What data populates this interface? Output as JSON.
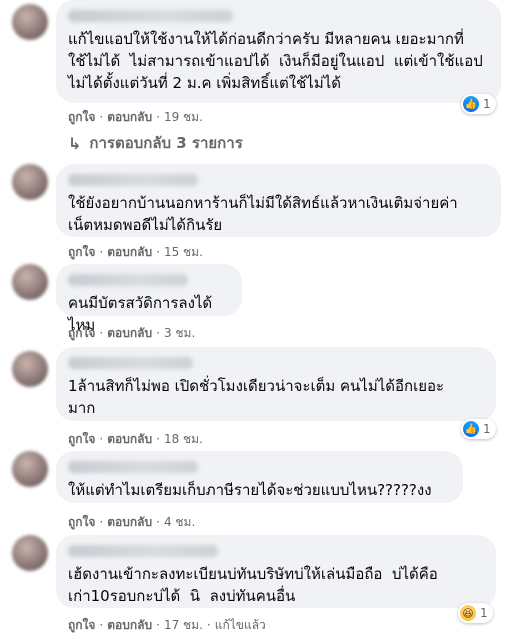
{
  "comments": [
    {
      "text": "แก้ไขแอปให้ใช้งานให้ได้ก่อนดีกว่าครับ มีหลายคน เยอะมากที่\nใช้ไม่ได้  ไม่สามารถเข้าแอปได้  เงินก็มีอยู่ในแอป  แต่เข้าใช้แอป\nไม่ได้ตั้งแต่วันที่ 2 ม.ค เพิ่มสิทธิ์แต่ใช้ไม่ได้",
      "like_label": "ถูกใจ",
      "reply_label": "ตอบกลับ",
      "time": "19 ชม.",
      "reaction_count": "1",
      "reaction_icon": "like-icon"
    },
    {
      "text": "ใช้ยังอยากบ้านนอกหาร้านก็ไม่มีใด้สิทธ์แล้วหาเงินเติมจ่ายค่า\nเน็ตหมดพอดีไม่ได้กินรัย",
      "like_label": "ถูกใจ",
      "reply_label": "ตอบกลับ",
      "time": "15 ชม."
    },
    {
      "text": "คนมีบัตรสวัดิการลงได้ไหม",
      "like_label": "ถูกใจ",
      "reply_label": "ตอบกลับ",
      "time": "3 ชม."
    },
    {
      "text": "1ล้านสิทก็ไม่พอ เปิดชั่วโมงเดียวน่าจะเต็ม คนไม่ได้อีกเยอะ\nมาก",
      "like_label": "ถูกใจ",
      "reply_label": "ตอบกลับ",
      "time": "18 ชม.",
      "reaction_count": "1",
      "reaction_icon": "like-icon"
    },
    {
      "text": "ให้แต่ทำไมเตรียมเก็บภาษีรายได้จะช่วยแบบไหน?????งง",
      "like_label": "ถูกใจ",
      "reply_label": "ตอบกลับ",
      "time": "4 ชม."
    },
    {
      "text": "เฮ้ดงานเข้ากะลงทะเบียนบ่ทันบริษัทบ่ให้เล่นมือถือ  บ่ได้คือ\nเก่า10รอบกะบ่ได้  นิ  ลงบ่ทันคนอื่น",
      "like_label": "ถูกใจ",
      "reply_label": "ตอบกลับ",
      "time": "17 ชม.",
      "edited_label": "แก้ไขแล้ว",
      "reaction_count": "1",
      "reaction_icon": "haha-icon"
    }
  ],
  "replies_link": "การตอบกลับ 3 รายการ",
  "colors": {
    "bubble": "#f0f2f5",
    "meta_text": "#65676b",
    "like_blue": "#0866ff"
  }
}
